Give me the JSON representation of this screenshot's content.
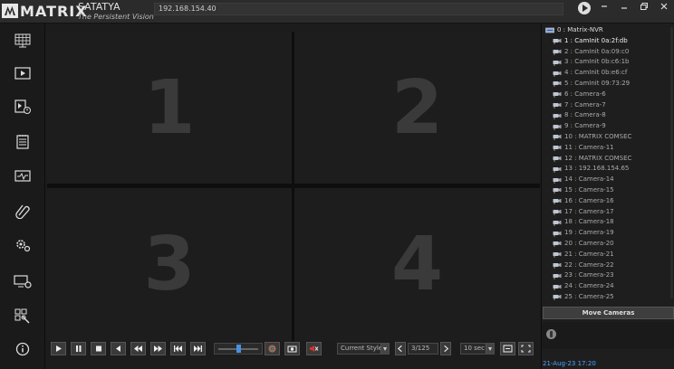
{
  "titlebar": {
    "logo_text": "MATRIX",
    "product_name": "SATATYA",
    "tagline": "The Persistent Vision",
    "address": "192.168.154.40",
    "window_controls": [
      "play-icon",
      "minimize-icon",
      "restore-icon",
      "close-icon"
    ]
  },
  "sidebar": {
    "items": [
      {
        "icon": "live-view-grid-icon"
      },
      {
        "icon": "playback-icon"
      },
      {
        "icon": "search-playback-icon"
      },
      {
        "icon": "event-log-icon"
      },
      {
        "icon": "health-status-icon"
      },
      {
        "icon": "attachment-icon"
      },
      {
        "icon": "settings-gears-icon"
      },
      {
        "icon": "device-settings-icon"
      },
      {
        "icon": "layout-tools-icon"
      },
      {
        "icon": "about-info-icon"
      }
    ]
  },
  "video_grid": {
    "tiles": [
      "1",
      "2",
      "3",
      "4"
    ]
  },
  "toolbar": {
    "style_select": "Current Style",
    "page_indicator": "3/125",
    "interval_select": "10 sec",
    "slider_level": 0.5
  },
  "camera_tree": {
    "root": "0 : Matrix-NVR",
    "items": [
      "1 : CamInit 0a:2f:db",
      "2 : CamInit 0a:09:c0",
      "3 : CamInit 0b:c6:1b",
      "4 : CamInit 0b:e6:cf",
      "5 : CamInit 09:73:29",
      "6 : Camera-6",
      "7 : Camera-7",
      "8 : Camera-8",
      "9 : Camera-9",
      "10 : MATRIX COMSEC",
      "11 : Camera-11",
      "12 : MATRIX COMSEC",
      "13 : 192.168.154.65",
      "14 : Camera-14",
      "15 : Camera-15",
      "16 : Camera-16",
      "17 : Camera-17",
      "18 : Camera-18",
      "19 : Camera-19",
      "20 : Camera-20",
      "21 : Camera-21",
      "22 : Camera-22",
      "23 : Camera-23",
      "24 : Camera-24",
      "25 : Camera-25"
    ],
    "move_cameras_label": "Move Cameras"
  },
  "status": {
    "datetime": "21-Aug-23 17:20"
  },
  "colors": {
    "accent": "#4a90e2",
    "datetime": "#4da3ff",
    "mute_red": "#d9302c"
  }
}
